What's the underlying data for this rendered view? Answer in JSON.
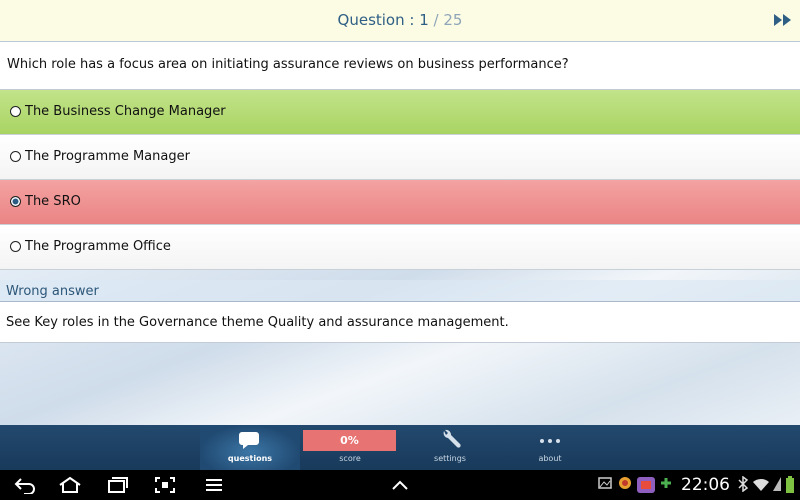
{
  "header": {
    "prefix": "Question : ",
    "current": "1",
    "slash": " / ",
    "total": "25"
  },
  "question": "Which role has a focus area on initiating assurance reviews on business performance?",
  "options": [
    {
      "label": "The Business Change Manager",
      "state": "correct"
    },
    {
      "label": "The Programme Manager",
      "state": "none"
    },
    {
      "label": "The SRO",
      "state": "selected-wrong"
    },
    {
      "label": "The Programme Office",
      "state": "none"
    }
  ],
  "feedback": {
    "verdict": "Wrong answer",
    "explanation": "See Key roles in the Governance theme Quality and assurance management."
  },
  "tabs": [
    {
      "label": "questions",
      "icon": "speech-bubble-icon",
      "active": true
    },
    {
      "label": "score",
      "value": "0%"
    },
    {
      "label": "settings",
      "icon": "wrench-icon"
    },
    {
      "label": "about",
      "icon": "dots-icon"
    }
  ],
  "status": {
    "time": "22:06"
  },
  "colors": {
    "correct": "#b4dc74",
    "wrong": "#ee8f8f",
    "tabbar": "#1f4468",
    "title": "#2f5f85"
  }
}
